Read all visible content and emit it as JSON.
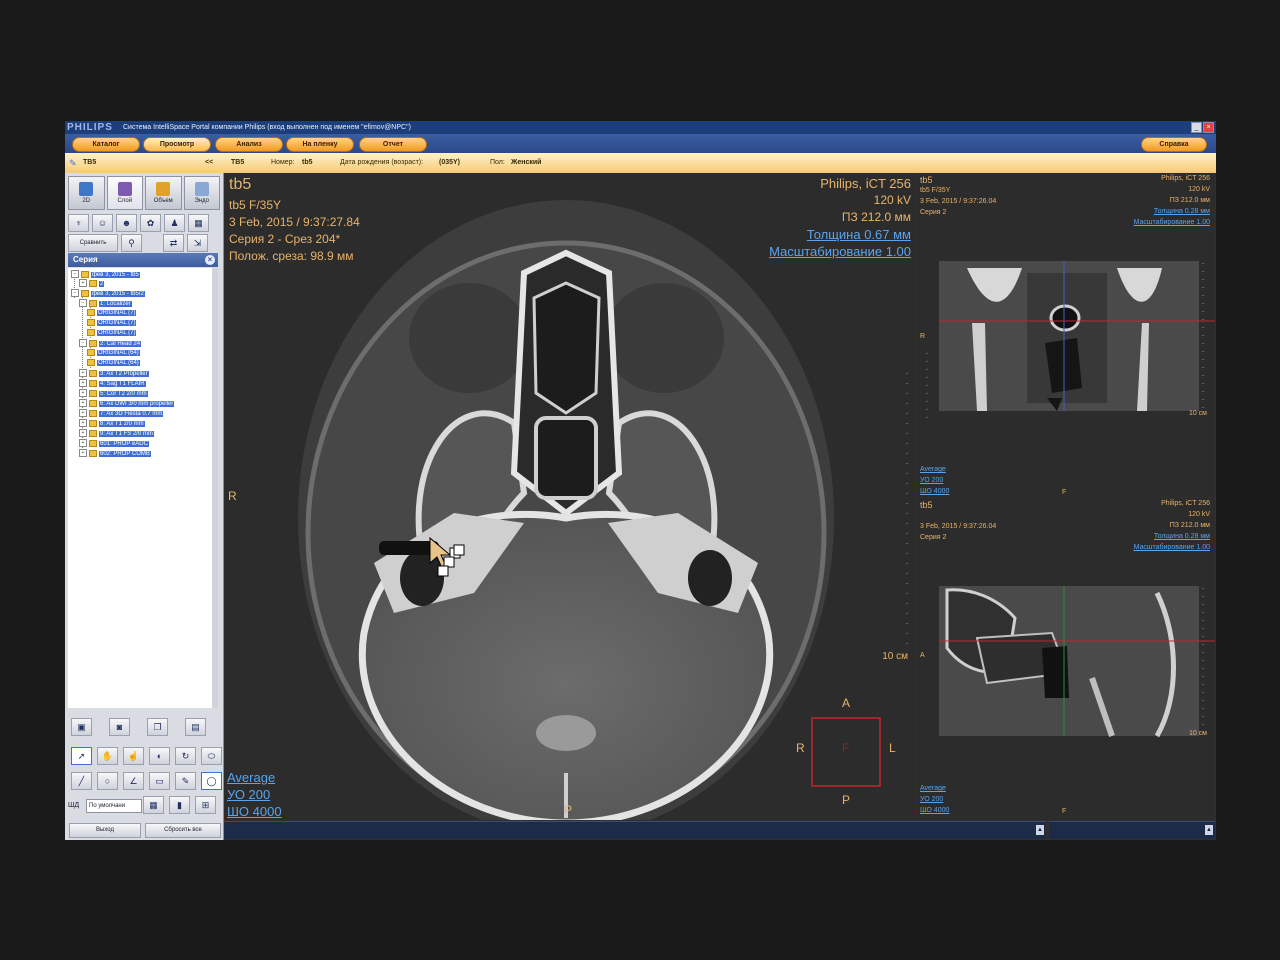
{
  "titlebar": {
    "logo": "PHILIPS",
    "title": "Система IntelliSpace Portal компании Philips (вход выполнен под именем \"efimov@NPC\")"
  },
  "menu": {
    "catalog": "Каталог",
    "view": "Просмотр",
    "analysis": "Анализ",
    "film": "На пленку",
    "report": "Отчет",
    "help": "Справка"
  },
  "patient": {
    "panel_name": "TB5",
    "collapse": "<<",
    "name": "TB5",
    "number_label": "Номер:",
    "number": "tb5",
    "dob_label": "Дата рождения (возраст):",
    "dob": "(035Y)",
    "sex_label": "Пол:",
    "sex": "Женский"
  },
  "modes": [
    {
      "label": "2D",
      "color": "#3e77c8"
    },
    {
      "label": "Слой",
      "color": "#7e5ab0"
    },
    {
      "label": "Объем",
      "color": "#e0a22a"
    },
    {
      "label": "Эндо",
      "color": "#8aa8d6"
    }
  ],
  "compare_label": "Сравнить",
  "series_header": "Серия",
  "tree": [
    "фев 3, 2015 - tb5",
    "2",
    "фев 3, 2015 - tb5/2",
    "1: Localizer",
    "ORIGINAL (7)",
    "ORIGINAL (7)",
    "ORIGINAL (7)",
    "2: Cal Head 24",
    "ORIGINAL (64)",
    "ORIGINAL (64)",
    "3: Ax T2 Propeller",
    "4: Sag T1 FLAIR",
    "5: Cor T2 2/0 mm",
    "6: Ax DWI 3/0 mm propeller",
    "7: Ax 3D Fiesta 0.7 mm",
    "8: Ax T1 2/0 mm",
    "9: Ax T1 FS 2/0 mm",
    "601: PROP eADC",
    "602: PROP COMB"
  ],
  "window_label": "ШД",
  "window_select": "По умолчани",
  "exit_label": "Выход",
  "reset_label": "Сбросить все",
  "main_view": {
    "id": "tb5",
    "patient": "tb5 F/35Y",
    "datetime": "3 Feb, 2015 / 9:37:27.84",
    "series": "Серия 2 - Срез 204*",
    "slice_pos": "Полож. среза: 98.9 мм",
    "scanner": "Philips, iCT 256",
    "kv": "120 kV",
    "fov": "ПЗ 212.0 мм",
    "thickness": "Толщина 0.67 мм",
    "zoom": "Масштабирование 1.00",
    "left": "R",
    "scale": "10 см",
    "bottom": "P",
    "wl_mode": "Average",
    "wl_center": "УО   200",
    "wl_width": "ШО  4000",
    "cube_a": "A",
    "cube_r": "R",
    "cube_f": "F",
    "cube_l": "L",
    "cube_p": "P"
  },
  "coronal_view": {
    "id": "tb5",
    "patient": "tb5 F/35Y",
    "datetime": "3 Feb, 2015 / 9:37:26.04",
    "series": "Серия 2",
    "scanner": "Philips, iCT 256",
    "kv": "120 kV",
    "fov": "ПЗ 212.0 мм",
    "thickness": "Толщина 0.28 мм",
    "zoom": "Масштабирование 1.00",
    "left": "R",
    "scale": "10 см",
    "bottom": "F",
    "wl_mode": "Average",
    "wl_center": "УО   200",
    "wl_width": "ШО  4000"
  },
  "sagittal_view": {
    "id": "tb5",
    "datetime": "3 Feb, 2015 / 9:37:26.04",
    "series": "Серия 2",
    "scanner": "Philips, iCT 256",
    "kv": "120 kV",
    "fov": "ПЗ 212.0 мм",
    "thickness": "Толщина 0.28 мм",
    "zoom": "Масштабирование 1.00",
    "left": "A",
    "scale": "10 см",
    "bottom": "F",
    "wl_mode": "Average",
    "wl_center": "УО   200",
    "wl_width": "ШО  4000"
  },
  "colors": {
    "overlay_text": "#e8b36a",
    "overlay_link": "#5aa4ee",
    "menu_orange": "#f39a1f",
    "selection_blue": "#3f6ed4"
  }
}
